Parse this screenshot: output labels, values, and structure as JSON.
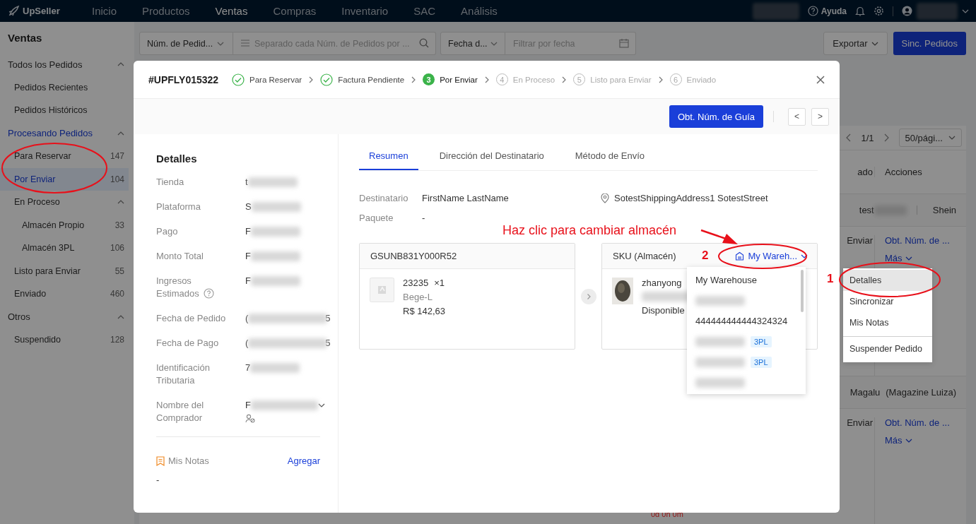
{
  "topbar": {
    "logo": "UpSeller",
    "nav": [
      {
        "label": "Inicio",
        "selected": false
      },
      {
        "label": "Productos",
        "selected": false
      },
      {
        "label": "Ventas",
        "selected": true
      },
      {
        "label": "Compras",
        "selected": false
      },
      {
        "label": "Inventario",
        "selected": false
      },
      {
        "label": "SAC",
        "selected": false
      },
      {
        "label": "Análisis",
        "selected": false
      }
    ],
    "help": "Ayuda"
  },
  "sidebar": {
    "title": "Ventas",
    "items": [
      {
        "label": "Todos los Pedidos",
        "active": false,
        "expanded": true,
        "selected": false,
        "children": [
          {
            "label": "Pedidos Recientes",
            "selected": false
          },
          {
            "label": "Pedidos Históricos",
            "selected": false
          }
        ]
      },
      {
        "label": "Procesando Pedidos",
        "active": true,
        "expanded": true,
        "selected": false,
        "children": [
          {
            "label": "Para Reservar",
            "count": "147",
            "selected": false
          },
          {
            "label": "Por Enviar",
            "count": "104",
            "selected": true
          },
          {
            "label": "En Proceso",
            "expanded": true,
            "selected": false,
            "children": [
              {
                "label": "Almacén Propio",
                "count": "33",
                "selected": false
              },
              {
                "label": "Almacén 3PL",
                "count": "106",
                "selected": false
              }
            ]
          },
          {
            "label": "Listo para Enviar",
            "count": "55",
            "selected": false
          },
          {
            "label": "Enviado",
            "count": "460",
            "selected": false
          }
        ]
      },
      {
        "label": "Otros",
        "active": false,
        "expanded": true,
        "selected": false,
        "children": [
          {
            "label": "Suspendido",
            "count": "128",
            "selected": false
          }
        ]
      }
    ]
  },
  "toolbar": {
    "order_field": "Núm. de Pedid...",
    "search_placeholder": "Separado cada Núm. de Pedidos por ...",
    "date_field": "Fecha d...",
    "date_placeholder": "Filtrar por fecha",
    "export": "Exportar",
    "sync": "Sinc. Pedidos"
  },
  "orders_table": {
    "pagination": "1/1",
    "page_size": "50/pági...",
    "columns": [
      "ado",
      "Acciones"
    ],
    "rows": [
      {
        "kind": "store",
        "store": "test",
        "platform": "Shein"
      },
      {
        "kind": "order",
        "status": "Enviar",
        "action": "Obt. Núm. de ...",
        "more": "Más"
      },
      {
        "kind": "store",
        "store": "Magalu",
        "platform": "(Magazine Luiza)"
      },
      {
        "kind": "order",
        "status": "Enviar",
        "action": "Obt. Núm. de ...",
        "more": "Más",
        "timer": "0d 0h 0m"
      }
    ]
  },
  "more_menu": {
    "items": [
      {
        "label": "Detalles",
        "highlighted": true,
        "divider_before": false
      },
      {
        "label": "Sincronizar",
        "highlighted": false,
        "divider_before": false
      },
      {
        "label": "Mis Notas",
        "highlighted": false,
        "divider_before": false
      },
      {
        "label": "Suspender Pedido",
        "highlighted": false,
        "divider_before": true
      }
    ]
  },
  "modal": {
    "order_id": "#UPFLY015322",
    "steps": [
      {
        "label": "Para Reservar",
        "completed": true,
        "current": false
      },
      {
        "label": "Factura Pendiente",
        "completed": true,
        "current": false
      },
      {
        "label": "Por Enviar",
        "completed": false,
        "current": true,
        "number": "3"
      },
      {
        "label": "En Proceso",
        "completed": false,
        "current": false,
        "number": "4"
      },
      {
        "label": "Listo para Enviar",
        "completed": false,
        "current": false,
        "number": "5"
      },
      {
        "label": "Enviado",
        "completed": false,
        "current": false,
        "number": "6"
      }
    ],
    "primary_button": "Obt. Núm. de Guía",
    "prev": "<",
    "next": ">",
    "details": {
      "title": "Detalles",
      "rows": [
        {
          "label": "Tienda",
          "value": "t",
          "kind": "text"
        },
        {
          "label": "Plataforma",
          "value": "S",
          "kind": "text"
        },
        {
          "label": "Pago",
          "value": "F",
          "kind": "text"
        },
        {
          "label": "Monto Total",
          "value": "F",
          "kind": "text"
        },
        {
          "label": "Ingresos Estimados",
          "value": "F",
          "kind": "help"
        },
        {
          "label": "Fecha de Pedido",
          "value": "(",
          "tail": "5",
          "kind": "text"
        },
        {
          "label": "Fecha de Pago",
          "value": "(",
          "tail": "5",
          "kind": "text"
        },
        {
          "label": "Identificación Tributaria",
          "value": "7",
          "kind": "text"
        },
        {
          "label": "Nombre del Comprador",
          "value": "F",
          "kind": "buyer"
        }
      ]
    },
    "notes": {
      "title": "Mis Notas",
      "action": "Agregar",
      "value": "-"
    },
    "tabs": [
      {
        "label": "Resumen",
        "selected": true
      },
      {
        "label": "Dirección del Destinatario",
        "selected": false
      },
      {
        "label": "Método de Envío",
        "selected": false
      }
    ],
    "summary": {
      "recipient_label": "Destinatario",
      "recipient": "FirstName LastName",
      "address": "SotestShippingAddress1 SotestStreet",
      "package_label": "Paquete",
      "package": "-"
    },
    "source_card": {
      "header": "GSUNB831Y000R52",
      "sku": "23235",
      "quantity": "×1",
      "variant": "Bege-L",
      "price": "R$ 142,63"
    },
    "target_card": {
      "header": "SKU (Almacén)",
      "warehouse": "My Wareh...",
      "name": "zhanyong",
      "stock_label": "Disponible"
    },
    "warehouse_options": [
      {
        "kind": "text",
        "label": "My Warehouse"
      },
      {
        "kind": "blurred"
      },
      {
        "kind": "text",
        "label": "444444444444324324"
      },
      {
        "kind": "blurred",
        "badge": "3PL"
      },
      {
        "kind": "blurred",
        "badge": "3PL"
      },
      {
        "kind": "blurred"
      }
    ]
  },
  "annotations": {
    "hint": "Haz clic para cambiar almacén",
    "step_two": "2",
    "step_one": "1"
  }
}
